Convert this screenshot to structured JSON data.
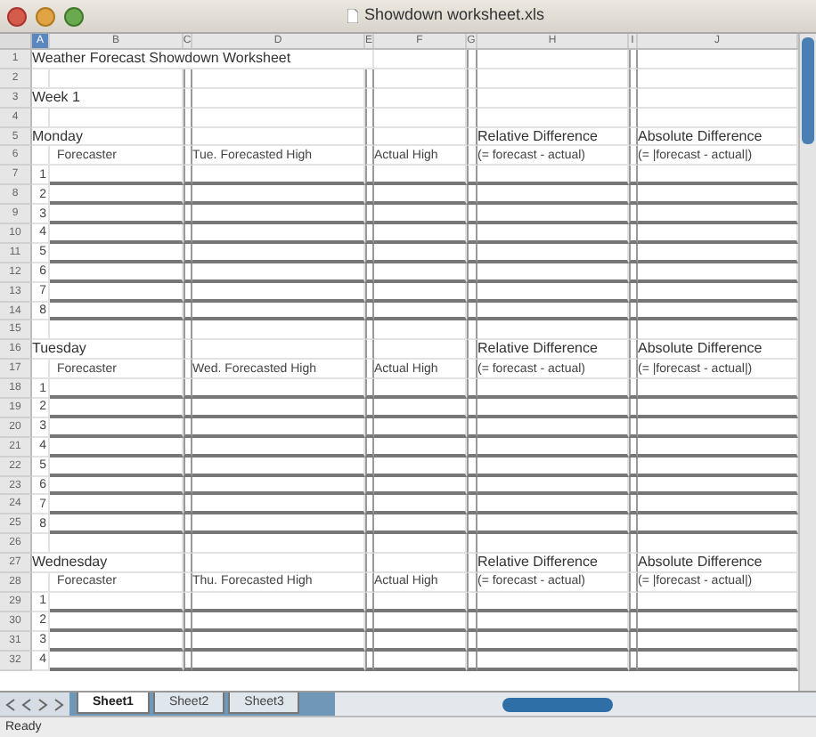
{
  "window": {
    "title": "Showdown worksheet.xls"
  },
  "columns": [
    {
      "label": "A",
      "selected": true
    },
    {
      "label": "B",
      "selected": false
    },
    {
      "label": "C",
      "selected": false
    },
    {
      "label": "D",
      "selected": false
    },
    {
      "label": "E",
      "selected": false
    },
    {
      "label": "F",
      "selected": false
    },
    {
      "label": "G",
      "selected": false
    },
    {
      "label": "H",
      "selected": false
    },
    {
      "label": "I",
      "selected": false
    },
    {
      "label": "J",
      "selected": false
    }
  ],
  "rows": [
    {
      "number": "1",
      "kind": "title",
      "cells": {
        "a": "Weather Forecast Showdown Worksheet"
      }
    },
    {
      "number": "2",
      "kind": "blank",
      "cells": {}
    },
    {
      "number": "3",
      "kind": "label",
      "cells": {
        "a": "Week 1"
      }
    },
    {
      "number": "4",
      "kind": "blank",
      "cells": {}
    },
    {
      "number": "5",
      "kind": "label",
      "cells": {
        "a": "Monday",
        "h": "Relative Difference",
        "j": "Absolute Difference"
      }
    },
    {
      "number": "6",
      "kind": "header",
      "cells": {
        "b": "Forecaster",
        "d": "Tue. Forecasted High",
        "f": "Actual High",
        "h": "(= forecast - actual)",
        "j": "(= |forecast - actual|)"
      }
    },
    {
      "number": "7",
      "kind": "entry",
      "cells": {
        "a": "1"
      }
    },
    {
      "number": "8",
      "kind": "entry",
      "cells": {
        "a": "2"
      }
    },
    {
      "number": "9",
      "kind": "entry",
      "cells": {
        "a": "3"
      }
    },
    {
      "number": "10",
      "kind": "entry",
      "cells": {
        "a": "4"
      }
    },
    {
      "number": "11",
      "kind": "entry",
      "cells": {
        "a": "5"
      }
    },
    {
      "number": "12",
      "kind": "entry",
      "cells": {
        "a": "6"
      }
    },
    {
      "number": "13",
      "kind": "entry",
      "cells": {
        "a": "7"
      }
    },
    {
      "number": "14",
      "kind": "entry",
      "cells": {
        "a": "8"
      }
    },
    {
      "number": "15",
      "kind": "blank",
      "cells": {}
    },
    {
      "number": "16",
      "kind": "label",
      "cells": {
        "a": "Tuesday",
        "h": "Relative Difference",
        "j": "Absolute Difference"
      }
    },
    {
      "number": "17",
      "kind": "header",
      "cells": {
        "b": "Forecaster",
        "d": "Wed. Forecasted High",
        "f": "Actual High",
        "h": "(= forecast - actual)",
        "j": "(= |forecast - actual|)"
      }
    },
    {
      "number": "18",
      "kind": "entry",
      "cells": {
        "a": "1"
      }
    },
    {
      "number": "19",
      "kind": "entry",
      "cells": {
        "a": "2"
      }
    },
    {
      "number": "20",
      "kind": "entry",
      "cells": {
        "a": "3"
      }
    },
    {
      "number": "21",
      "kind": "entry",
      "cells": {
        "a": "4"
      }
    },
    {
      "number": "22",
      "kind": "entry",
      "cells": {
        "a": "5"
      }
    },
    {
      "number": "23",
      "kind": "entry",
      "cells": {
        "a": "6"
      }
    },
    {
      "number": "24",
      "kind": "entry",
      "cells": {
        "a": "7"
      }
    },
    {
      "number": "25",
      "kind": "entry",
      "cells": {
        "a": "8"
      }
    },
    {
      "number": "26",
      "kind": "blank",
      "cells": {}
    },
    {
      "number": "27",
      "kind": "label",
      "cells": {
        "a": "Wednesday",
        "h": "Relative Difference",
        "j": "Absolute Difference"
      }
    },
    {
      "number": "28",
      "kind": "header",
      "cells": {
        "b": "Forecaster",
        "d": "Thu. Forecasted High",
        "f": "Actual High",
        "h": "(= forecast - actual)",
        "j": "(= |forecast - actual|)"
      }
    },
    {
      "number": "29",
      "kind": "entry",
      "cells": {
        "a": "1"
      }
    },
    {
      "number": "30",
      "kind": "entry",
      "cells": {
        "a": "2"
      }
    },
    {
      "number": "31",
      "kind": "entry",
      "cells": {
        "a": "3"
      }
    },
    {
      "number": "32",
      "kind": "entry",
      "cells": {
        "a": "4"
      }
    }
  ],
  "sheet_tabs": [
    {
      "label": "Sheet1",
      "selected": true
    },
    {
      "label": "Sheet2",
      "selected": false
    },
    {
      "label": "Sheet3",
      "selected": false
    }
  ],
  "status_bar": {
    "text": "Ready"
  }
}
